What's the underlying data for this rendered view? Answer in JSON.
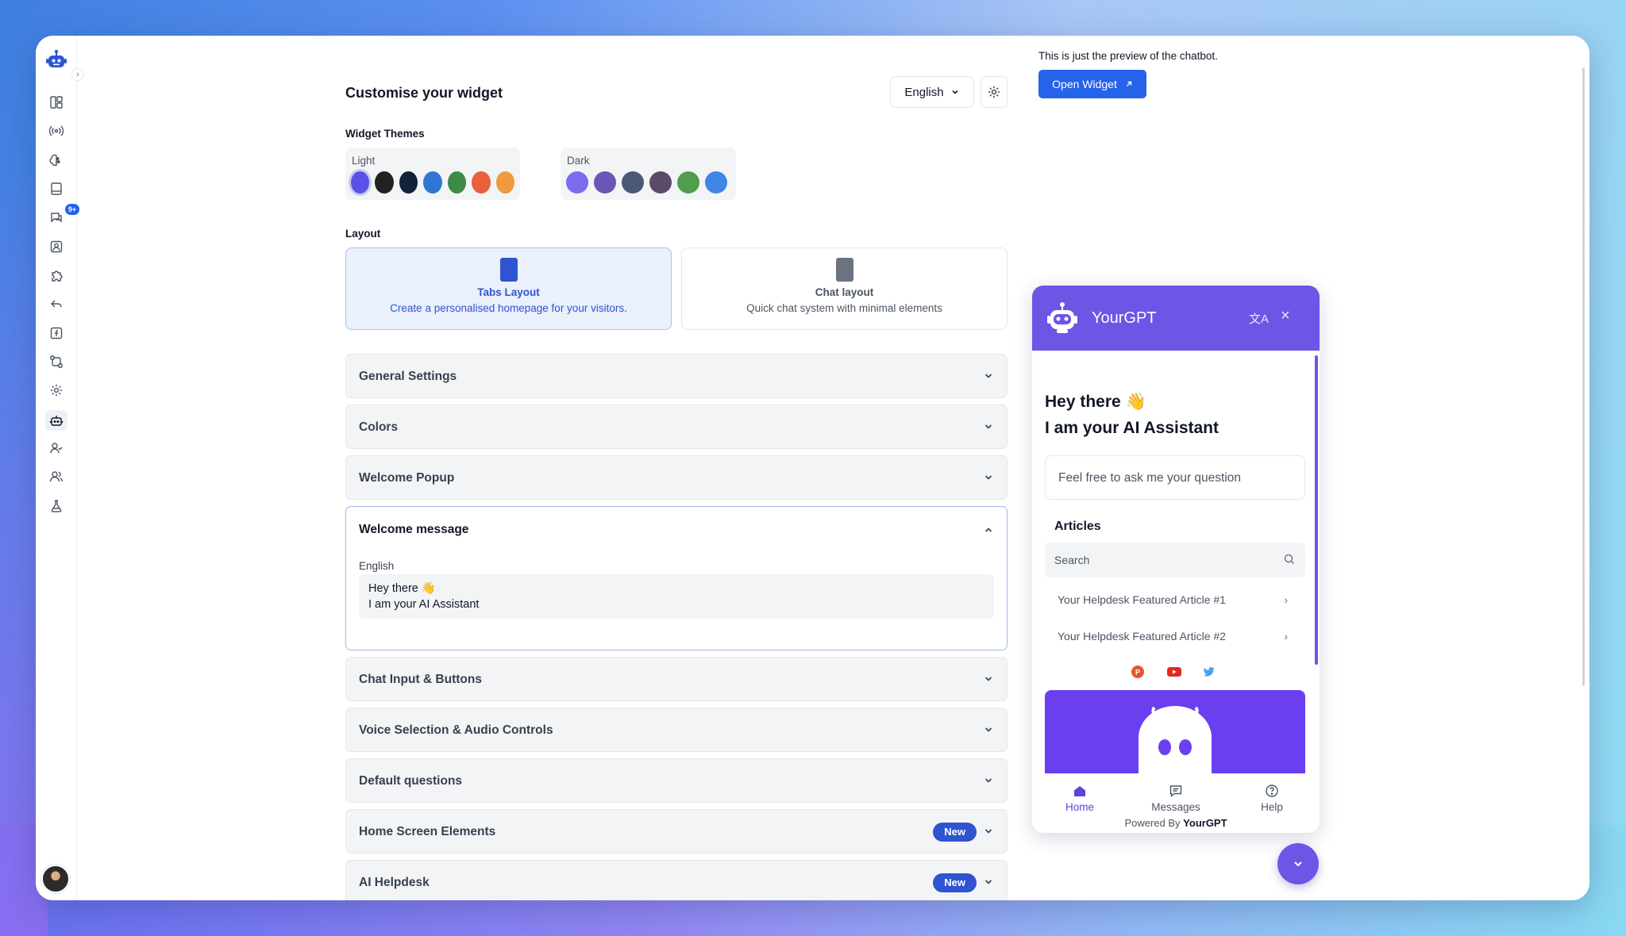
{
  "sidebar": {
    "badge": "9+",
    "icons": [
      "dashboard-icon",
      "broadcast-icon",
      "brain-icon",
      "book-icon",
      "chat-icon",
      "contact-icon",
      "puzzle-icon",
      "reply-icon",
      "function-icon",
      "workflow-icon",
      "settings-icon",
      "bot-icon",
      "user-check-icon",
      "users-icon",
      "flask-icon"
    ]
  },
  "header": {
    "title": "Customise your widget",
    "language": "English"
  },
  "themes": {
    "section_label": "Widget Themes",
    "light": {
      "label": "Light",
      "colors": [
        "#5a52e6",
        "#222222",
        "#14213d",
        "#3077d3",
        "#3f8a47",
        "#e9603a",
        "#f09a3e"
      ]
    },
    "dark": {
      "label": "Dark",
      "colors": [
        "#7c6cf0",
        "#6b55b5",
        "#4a5876",
        "#5b4a68",
        "#4f9d4d",
        "#3d86e5"
      ]
    }
  },
  "layout": {
    "section_label": "Layout",
    "tabs": {
      "title": "Tabs Layout",
      "desc": "Create a personalised homepage for your visitors."
    },
    "chat": {
      "title": "Chat layout",
      "desc": "Quick chat system with minimal elements"
    }
  },
  "accordions": {
    "general": "General Settings",
    "colors": "Colors",
    "popup": "Welcome Popup",
    "welcome": {
      "label": "Welcome message",
      "field_label": "English",
      "value": "Hey there 👋\nI am your AI Assistant"
    },
    "chat_input": "Chat Input & Buttons",
    "voice": "Voice Selection & Audio Controls",
    "default_q": "Default questions",
    "home_screen": "Home Screen Elements",
    "helpdesk": "AI Helpdesk",
    "new_badge": "New"
  },
  "preview": {
    "note": "This is just the preview of the chatbot.",
    "open_button": "Open Widget",
    "widget": {
      "name": "YourGPT",
      "greeting": "Hey there 👋\nI am your AI Assistant",
      "ask_placeholder": "Feel free to ask me your question",
      "articles_heading": "Articles",
      "search_placeholder": "Search",
      "articles": [
        "Your Helpdesk Featured Article #1",
        "Your Helpdesk Featured Article #2"
      ],
      "nav": {
        "home": "Home",
        "messages": "Messages",
        "help": "Help"
      },
      "powered_prefix": "Powered By",
      "powered_brand": "YourGPT",
      "accent": "#6e55e6"
    }
  }
}
